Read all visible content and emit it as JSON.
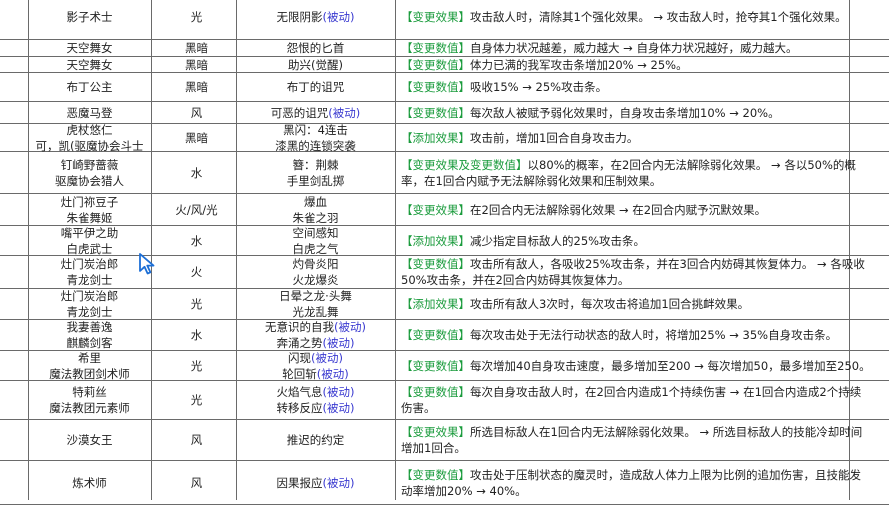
{
  "rows": [
    {
      "name": [
        "影子术士"
      ],
      "attr": "光",
      "skills": [
        {
          "text": "无限阴影",
          "passive": "(被动)"
        }
      ],
      "tag": "【变更效果】",
      "desc": [
        "攻击敌人时，清除其1个强化效果。 → 攻击敌人时，抢夺其1个强化效果。"
      ]
    },
    {
      "name": [
        "天空舞女"
      ],
      "attr": "黑暗",
      "skills": [
        {
          "text": "怨恨的匕首",
          "passive": ""
        }
      ],
      "tag": "【变更数值】",
      "desc": [
        "自身体力状况越差，威力越大 → 自身体力状况越好，威力越大。"
      ]
    },
    {
      "name": [
        "天空舞女"
      ],
      "attr": "黑暗",
      "skills": [
        {
          "text": "助兴(觉醒)",
          "passive": ""
        }
      ],
      "tag": "【变更数值】",
      "desc": [
        "体力已满的我军攻击条增加20% → 25%。"
      ]
    },
    {
      "name": [
        "布丁公主"
      ],
      "attr": "黑暗",
      "skills": [
        {
          "text": "布丁的诅咒",
          "passive": ""
        }
      ],
      "tag": "【变更数值】",
      "desc": [
        "吸收15% → 25%攻击条。"
      ]
    },
    {
      "name": [
        "恶魔马登"
      ],
      "attr": "风",
      "skills": [
        {
          "text": "可恶的诅咒",
          "passive": "(被动)"
        }
      ],
      "tag": "【变更数值】",
      "desc": [
        "每次敌人被赋予弱化效果时，自身攻击条增加10% → 20%。"
      ]
    },
    {
      "name": [
        "虎杖悠仁",
        "可，凯(驱魔协会斗士"
      ],
      "attr": "黑暗",
      "skills": [
        {
          "text": "黑闪：4连击",
          "passive": ""
        },
        {
          "text": "漆黑的连锁突袭",
          "passive": ""
        }
      ],
      "tag": "【添加效果】",
      "desc": [
        "攻击前，增加1回合自身攻击力。"
      ]
    },
    {
      "name": [
        "钉崎野蔷薇",
        "驱魔协会猎人"
      ],
      "attr": "水",
      "skills": [
        {
          "text": "簪：荆棘",
          "passive": ""
        },
        {
          "text": "手里剑乱掷",
          "passive": ""
        }
      ],
      "tag": "【变更效果及变更数值】",
      "desc": [
        "以80%的概率，在2回合内无法解除弱化效果。 → 各以50%的概",
        "率，在1回合内赋予无法解除弱化效果和压制效果。"
      ]
    },
    {
      "name": [
        "灶门祢豆子",
        "朱雀舞姬"
      ],
      "attr": "火/风/光",
      "skills": [
        {
          "text": "爆血",
          "passive": ""
        },
        {
          "text": "朱雀之羽",
          "passive": ""
        }
      ],
      "tag": "【变更效果】",
      "desc": [
        "在2回合内无法解除弱化效果 → 在2回合内赋予沉默效果。"
      ]
    },
    {
      "name": [
        "嘴平伊之助",
        "白虎武士"
      ],
      "attr": "水",
      "skills": [
        {
          "text": "空间感知",
          "passive": ""
        },
        {
          "text": "白虎之气",
          "passive": ""
        }
      ],
      "tag": "【添加效果】",
      "desc": [
        "减少指定目标敌人的25%攻击条。"
      ]
    },
    {
      "name": [
        "灶门炭治郎",
        "青龙剑士"
      ],
      "attr": "火",
      "skills": [
        {
          "text": "灼骨炎阳",
          "passive": ""
        },
        {
          "text": "火龙爆炎",
          "passive": ""
        }
      ],
      "tag": "【变更数值】",
      "desc": [
        "攻击所有敌人，各吸收25%攻击条，并在3回合内妨碍其恢复体力。 → 各吸收",
        "50%攻击条，并在2回合内妨碍其恢复体力。"
      ]
    },
    {
      "name": [
        "灶门炭治郎",
        "青龙剑士"
      ],
      "attr": "光",
      "skills": [
        {
          "text": "日晕之龙·头舞",
          "passive": ""
        },
        {
          "text": "光龙乱舞",
          "passive": ""
        }
      ],
      "tag": "【添加效果】",
      "desc": [
        "攻击所有敌人3次时，每次攻击将追加1回合挑衅效果。"
      ]
    },
    {
      "name": [
        "我妻善逸",
        "麒麟剑客"
      ],
      "attr": "水",
      "skills": [
        {
          "text": "无意识的自我",
          "passive": "(被动)"
        },
        {
          "text": "奔涌之势",
          "passive": "(被动)"
        }
      ],
      "tag": "【变更数值】",
      "desc": [
        "每次攻击处于无法行动状态的敌人时，将增加25% → 35%自身攻击条。"
      ]
    },
    {
      "name": [
        "希里",
        "魔法教团剑术师"
      ],
      "attr": "光",
      "skills": [
        {
          "text": "闪现",
          "passive": "(被动)"
        },
        {
          "text": "轮回斩",
          "passive": "(被动)"
        }
      ],
      "tag": "【变更数值】",
      "desc": [
        "每次增加40自身攻击速度，最多增加至200 → 每次增加50，最多增加至250。"
      ]
    },
    {
      "name": [
        "特莉丝",
        "魔法教团元素师"
      ],
      "attr": "光",
      "skills": [
        {
          "text": "火焰气息",
          "passive": "(被动)"
        },
        {
          "text": "转移反应",
          "passive": "(被动)"
        }
      ],
      "tag": "【变更数值】",
      "desc": [
        "每次自身攻击敌人时，在2回合内造成1个持续伤害 → 在1回合内造成2个持续",
        "伤害。"
      ]
    },
    {
      "name": [
        "沙漠女王"
      ],
      "attr": "风",
      "skills": [
        {
          "text": "推迟的约定",
          "passive": ""
        }
      ],
      "tag": "【变更效果】",
      "desc": [
        "所选目标敌人在1回合内无法解除弱化效果。 → 所选目标敌人的技能冷却时间",
        "增加1回合。"
      ]
    },
    {
      "name": [
        "炼术师"
      ],
      "attr": "风",
      "skills": [
        {
          "text": "因果报应",
          "passive": "(被动)"
        }
      ],
      "tag": "【变更数值】",
      "desc": [
        "攻击处于压制状态的魔灵时，造成敌人体力上限为比例的追加伤害，且技能发",
        "动率增加20% → 40%。"
      ]
    }
  ]
}
